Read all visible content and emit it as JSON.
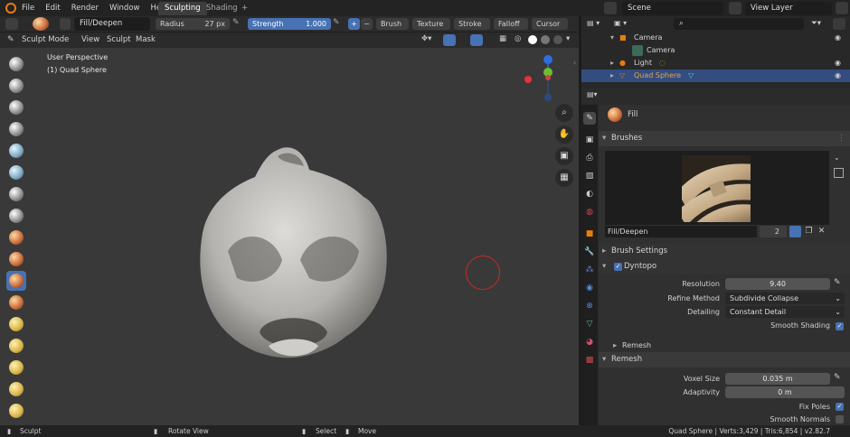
{
  "menu": {
    "items": [
      "File",
      "Edit",
      "Render",
      "Window",
      "Help"
    ]
  },
  "workspaces": {
    "active": "Sculpting",
    "other": "Shading",
    "add": "+"
  },
  "scene": {
    "label": "Scene"
  },
  "view_layer": {
    "label": "View Layer"
  },
  "tool_header": {
    "brush_name": "Fill/Deepen",
    "radius_label": "Radius",
    "radius_value": "27 px",
    "strength_label": "Strength",
    "strength_value": "1.000",
    "plus": "+",
    "minus": "−",
    "brush_menu": "Brush",
    "texture_menu": "Texture",
    "stroke_menu": "Stroke",
    "falloff_menu": "Falloff",
    "cursor_menu": "Cursor"
  },
  "header2": {
    "mode": "Sculpt Mode",
    "view": "View",
    "sculpt": "Sculpt",
    "mask": "Mask"
  },
  "viewport": {
    "line1": "User Perspective",
    "line2": "(1) Quad Sphere"
  },
  "gizmo": {
    "z": "Z",
    "y": "Y"
  },
  "outliner": {
    "rows": [
      {
        "name": "Camera"
      },
      {
        "name": "Camera"
      },
      {
        "name": "Light"
      },
      {
        "name": "Quad Sphere"
      }
    ]
  },
  "properties": {
    "active_tool": "Fill",
    "brushes_header": "Brushes",
    "brush_name": "Fill/Deepen",
    "brush_users": "2",
    "brush_settings": "Brush Settings",
    "dyntopo": "Dyntopo",
    "resolution_label": "Resolution",
    "resolution_value": "9.40",
    "refine_label": "Refine Method",
    "refine_value": "Subdivide Collapse",
    "detailing_label": "Detailing",
    "detailing_value": "Constant Detail",
    "smooth_shading": "Smooth Shading",
    "remesh_sub": "Remesh",
    "remesh_header": "Remesh",
    "voxel_label": "Voxel Size",
    "voxel_value": "0.035 m",
    "adaptivity_label": "Adaptivity",
    "adaptivity_value": "0 m",
    "fix_poles": "Fix Poles",
    "smooth_normals": "Smooth Normals"
  },
  "statusbar": {
    "sculpt": "Sculpt",
    "rotate": "Rotate View",
    "select": "Select",
    "move": "Move",
    "info": "Quad Sphere | Verts:3,429 | Tris:6,854 | v2.82.7"
  },
  "colors": {
    "accent": "#4772b3",
    "selected_row": "#334d80",
    "orange": "#e87d0d"
  }
}
